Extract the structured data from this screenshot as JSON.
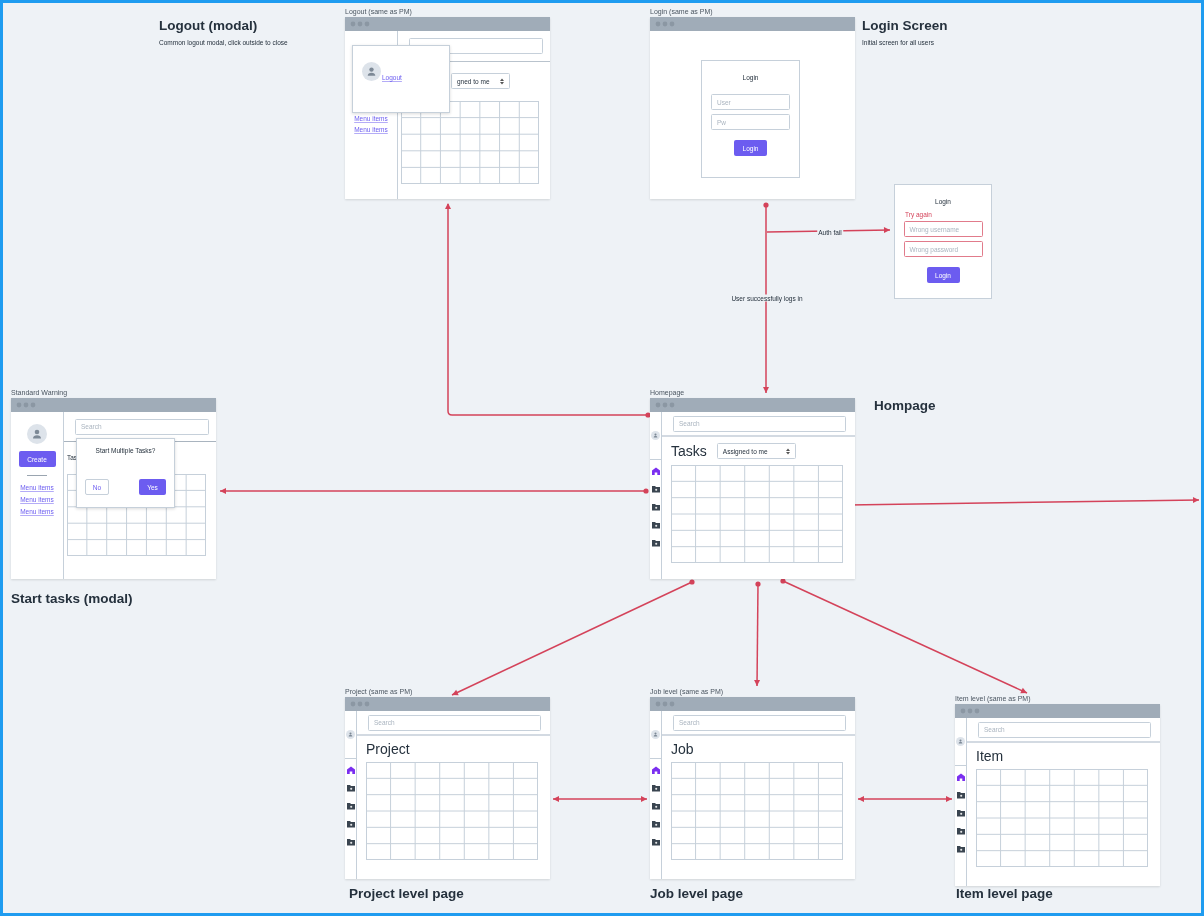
{
  "annotations": [
    {
      "title": "Logout (modal)",
      "description": "Common logout modal, click outside to close"
    },
    {
      "title": "Login Screen",
      "description": "Initial screen for all users"
    },
    {
      "title": "Hompage"
    },
    {
      "title": "Start tasks (modal)"
    },
    {
      "title": "Project level page"
    },
    {
      "title": "Job level page"
    },
    {
      "title": "Item level page"
    }
  ],
  "frames": [
    {
      "kind": "logout",
      "label": "Logout (same as PM)",
      "dropdown": "gned to me",
      "popup_link": "Logout",
      "menu_items": [
        "Menu items",
        "Menu items"
      ]
    },
    {
      "kind": "login",
      "label": "Login (same as PM)",
      "title": "Login",
      "fields": [
        {
          "placeholder": "User",
          "error": false
        },
        {
          "placeholder": "Pw",
          "error": false
        }
      ],
      "button": "Login"
    },
    {
      "kind": "login_card",
      "title": "Login",
      "error": "Try again",
      "fields": [
        {
          "placeholder": "Wrong username",
          "error": true
        },
        {
          "placeholder": "Wrong password",
          "error": true
        }
      ],
      "button": "Login"
    },
    {
      "kind": "warning",
      "label": "Standard Warning",
      "search": {
        "placeholder": "Search"
      },
      "create_button": "Create",
      "menu_items": [
        "Menu items",
        "Menu items",
        "Menu items"
      ],
      "heading": "Tas",
      "dialog": {
        "question": "Start Multiple Tasks?",
        "buttons": [
          "No",
          "Yes"
        ]
      }
    },
    {
      "kind": "page",
      "label": "Homepage",
      "search": {
        "placeholder": "Search"
      },
      "heading": "Tasks",
      "dropdown": "Assigned to me",
      "nav": [
        {
          "kind": "home",
          "selected": true
        },
        {
          "kind": "folder",
          "selected": false
        },
        {
          "kind": "folder",
          "selected": false
        },
        {
          "kind": "folder",
          "selected": false
        },
        {
          "kind": "folder",
          "selected": false
        }
      ]
    },
    {
      "kind": "page",
      "label": "Project (same as PM)",
      "search": {
        "placeholder": "Search"
      },
      "heading": "Project",
      "nav": [
        {
          "kind": "home",
          "selected": true
        },
        {
          "kind": "folder",
          "selected": false
        },
        {
          "kind": "folder",
          "selected": false
        },
        {
          "kind": "folder",
          "selected": false
        },
        {
          "kind": "folder",
          "selected": false
        }
      ]
    },
    {
      "kind": "page",
      "label": "Job level (same as PM)",
      "search": {
        "placeholder": "Search"
      },
      "heading": "Job",
      "nav": [
        {
          "kind": "home",
          "selected": true
        },
        {
          "kind": "folder",
          "selected": false
        },
        {
          "kind": "folder",
          "selected": false
        },
        {
          "kind": "folder",
          "selected": false
        },
        {
          "kind": "folder",
          "selected": false
        }
      ]
    },
    {
      "kind": "page",
      "label": "Item level (same as PM)",
      "search": {
        "placeholder": "Search"
      },
      "heading": "Item",
      "nav": [
        {
          "kind": "home",
          "selected": true
        },
        {
          "kind": "folder",
          "selected": false
        },
        {
          "kind": "folder",
          "selected": false
        },
        {
          "kind": "folder",
          "selected": false
        },
        {
          "kind": "folder",
          "selected": false
        }
      ]
    }
  ],
  "flow_labels": [
    "Auth fail",
    "User successfully logs in"
  ]
}
